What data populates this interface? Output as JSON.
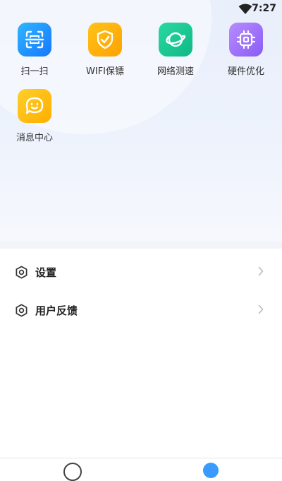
{
  "status_bar": {
    "time": "7:27"
  },
  "tools": [
    {
      "label": "扫一扫",
      "icon": "scan-icon",
      "color_from": "#2fb6ff",
      "color_to": "#1677ff"
    },
    {
      "label": "WIFI保镖",
      "icon": "shield-check-icon",
      "color_from": "#ffc21a",
      "color_to": "#ffa200"
    },
    {
      "label": "网络测速",
      "icon": "planet-icon",
      "color_from": "#29d9a0",
      "color_to": "#10b886"
    },
    {
      "label": "硬件优化",
      "icon": "chip-icon",
      "color_from": "#b78cff",
      "color_to": "#8a5cf5"
    },
    {
      "label": "消息中心",
      "icon": "chat-smile-icon",
      "color_from": "#ffcf2a",
      "color_to": "#ffae00"
    }
  ],
  "menu": [
    {
      "label": "设置",
      "icon": "hexagon-icon"
    },
    {
      "label": "用户反馈",
      "icon": "hexagon-icon"
    }
  ],
  "colors": {
    "background": "#ffffff",
    "top_gradient": "#e9effb",
    "divider": "#f3f4f7"
  }
}
